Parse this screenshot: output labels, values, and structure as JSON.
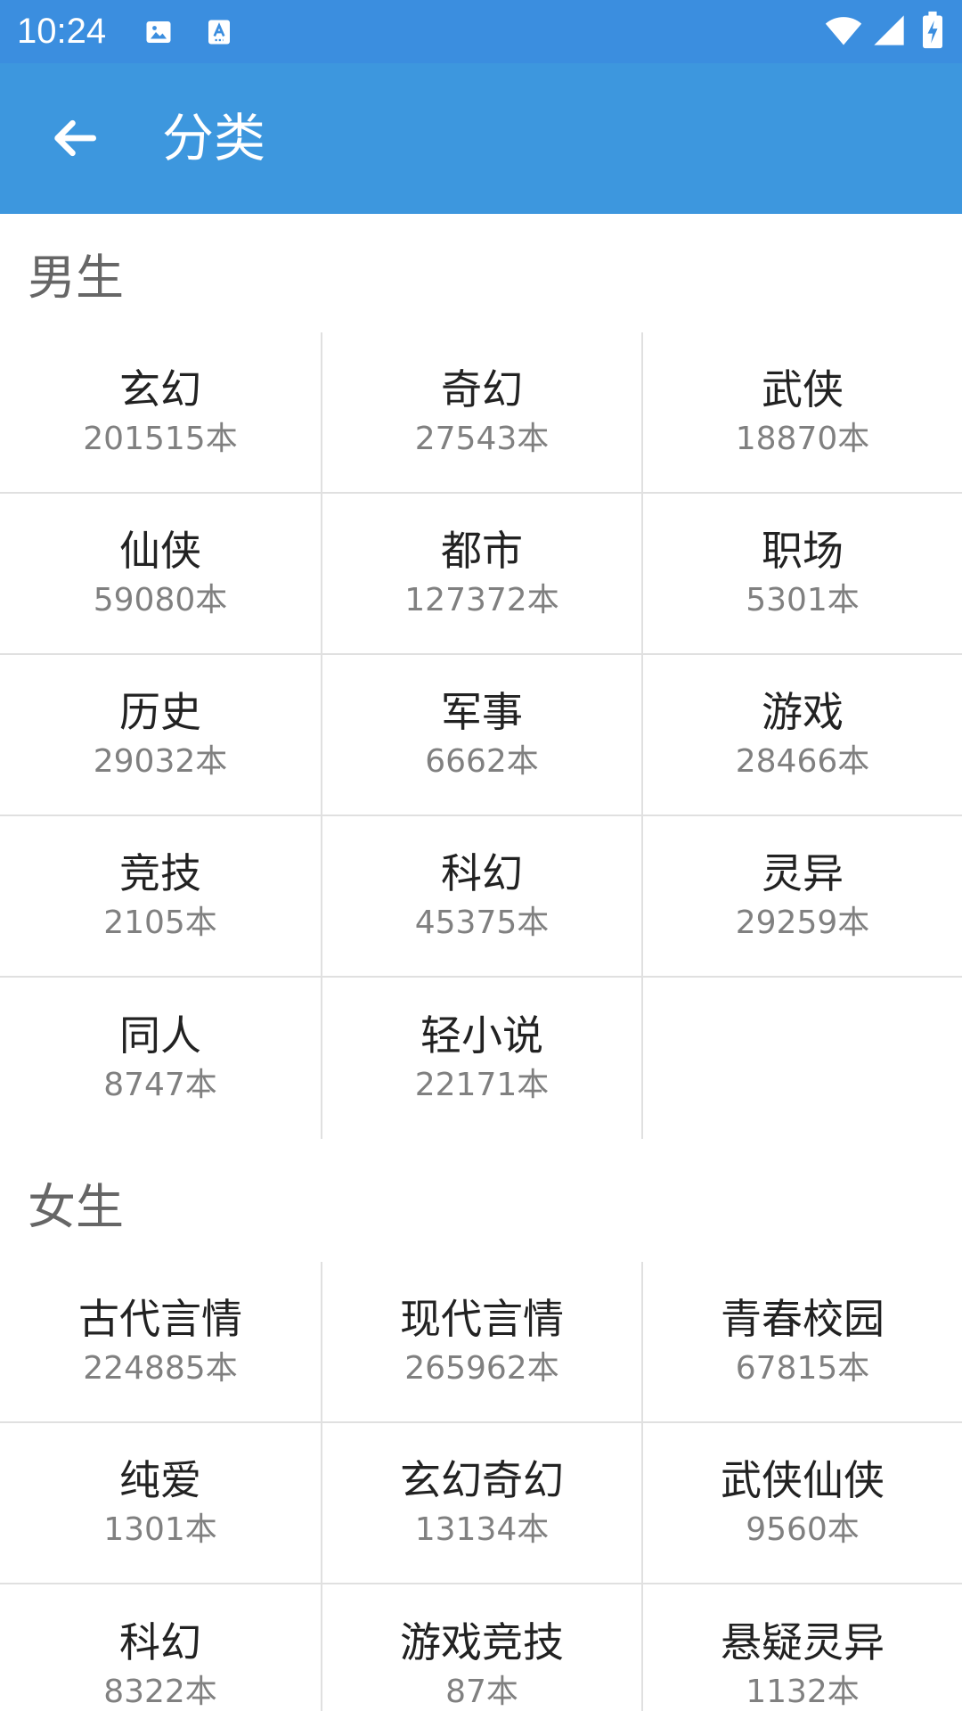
{
  "status_bar": {
    "time": "10:24",
    "left_icons": [
      "image-icon",
      "a-icon"
    ],
    "right_icons": [
      "wifi-icon",
      "signal-icon",
      "battery-charging-icon"
    ]
  },
  "app_bar": {
    "title": "分类",
    "back_icon": "arrow-left-icon",
    "background": "#3d97de"
  },
  "sections": [
    {
      "title": "男生",
      "items": [
        {
          "name": "玄幻",
          "count": "201515本"
        },
        {
          "name": "奇幻",
          "count": "27543本"
        },
        {
          "name": "武侠",
          "count": "18870本"
        },
        {
          "name": "仙侠",
          "count": "59080本"
        },
        {
          "name": "都市",
          "count": "127372本"
        },
        {
          "name": "职场",
          "count": "5301本"
        },
        {
          "name": "历史",
          "count": "29032本"
        },
        {
          "name": "军事",
          "count": "6662本"
        },
        {
          "name": "游戏",
          "count": "28466本"
        },
        {
          "name": "竞技",
          "count": "2105本"
        },
        {
          "name": "科幻",
          "count": "45375本"
        },
        {
          "name": "灵异",
          "count": "29259本"
        },
        {
          "name": "同人",
          "count": "8747本"
        },
        {
          "name": "轻小说",
          "count": "22171本"
        }
      ]
    },
    {
      "title": "女生",
      "items": [
        {
          "name": "古代言情",
          "count": "224885本"
        },
        {
          "name": "现代言情",
          "count": "265962本"
        },
        {
          "name": "青春校园",
          "count": "67815本"
        },
        {
          "name": "纯爱",
          "count": "1301本"
        },
        {
          "name": "玄幻奇幻",
          "count": "13134本"
        },
        {
          "name": "武侠仙侠",
          "count": "9560本"
        },
        {
          "name": "科幻",
          "count": "8322本"
        },
        {
          "name": "游戏竞技",
          "count": "87本"
        },
        {
          "name": "悬疑灵异",
          "count": "1132本"
        }
      ]
    }
  ]
}
